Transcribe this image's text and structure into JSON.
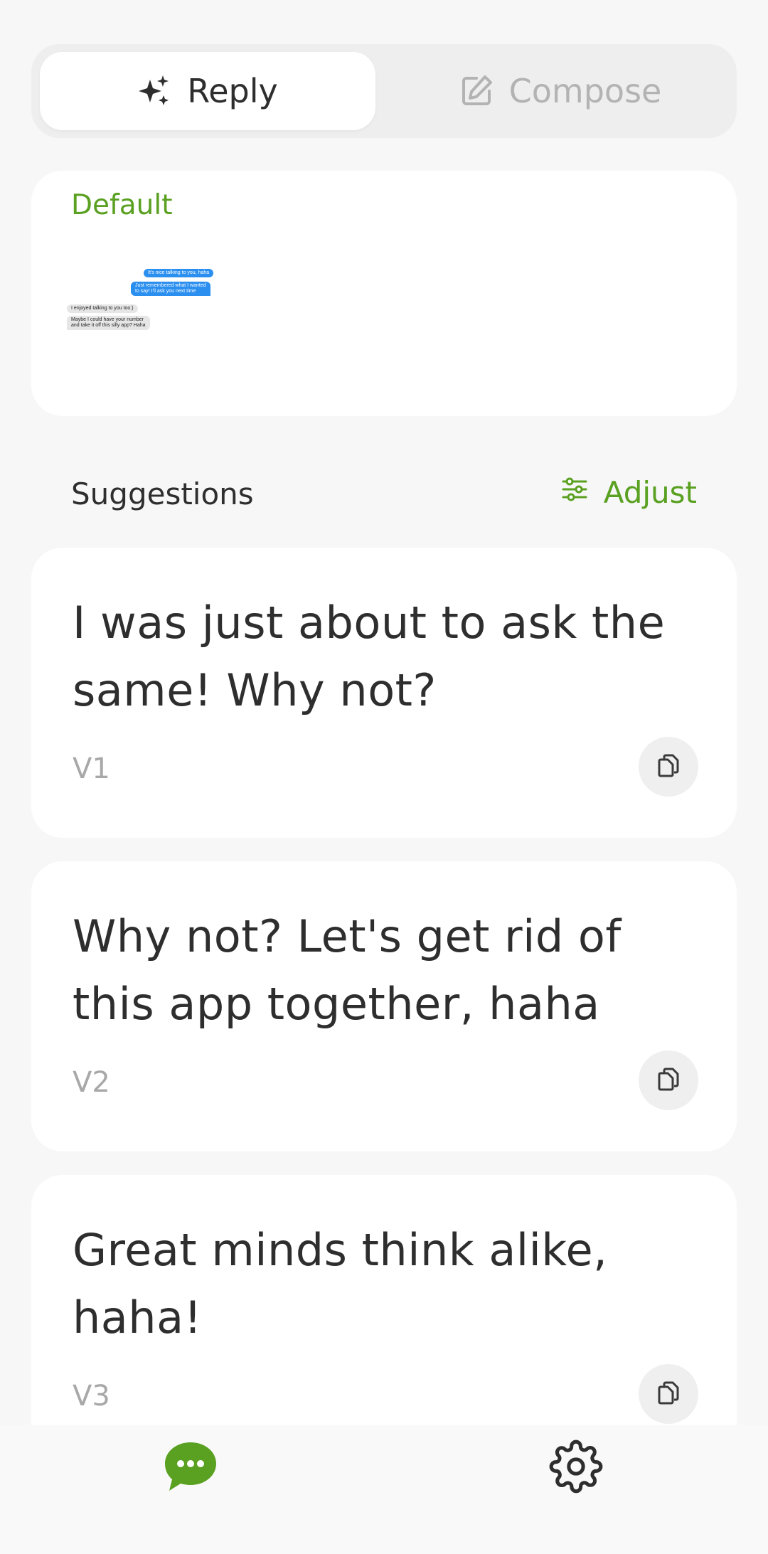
{
  "tabs": {
    "reply_label": "Reply",
    "compose_label": "Compose"
  },
  "default_card": {
    "label": "Default",
    "thumbnail_messages": [
      {
        "side": "out",
        "text": "It's nice talking to you, haha"
      },
      {
        "side": "out",
        "text": "Just remembered what I wanted"
      },
      {
        "side": "out",
        "text": "to say! I'll ask you next time"
      },
      {
        "side": "in",
        "text": "I enjoyed talking to you too:)"
      },
      {
        "side": "in",
        "text": "Maybe I could have your number"
      },
      {
        "side": "in",
        "text": "and take it off this silly app? Haha"
      }
    ]
  },
  "suggestions": {
    "title": "Suggestions",
    "adjust_label": "Adjust",
    "items": [
      {
        "text": "I was just about to ask the same! Why not?",
        "version": "V1"
      },
      {
        "text": "Why not? Let's get rid of this app together, haha",
        "version": "V2"
      },
      {
        "text": "Great minds think alike, haha!",
        "version": "V3"
      }
    ]
  },
  "colors": {
    "accent": "#5aa021",
    "background": "#f7f7f7",
    "card": "#ffffff",
    "muted": "#a8a8a8"
  },
  "icons": {
    "reply": "sparkles-icon",
    "compose": "edit-icon",
    "adjust": "sliders-icon",
    "copy": "copy-icon",
    "chat": "chat-bubble-icon",
    "settings": "gear-icon"
  }
}
